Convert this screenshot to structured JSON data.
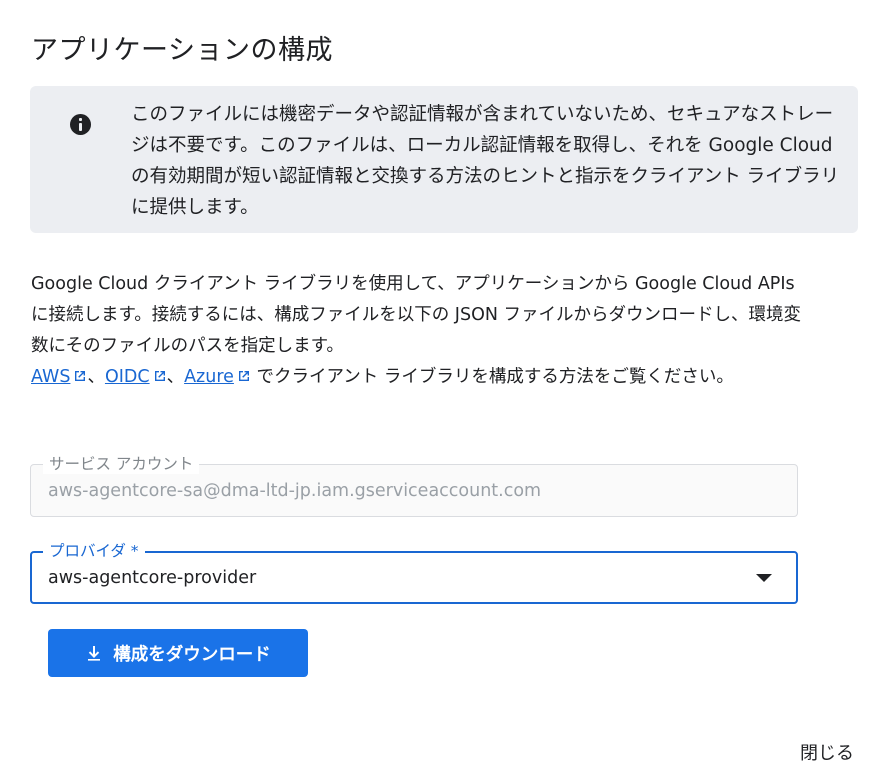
{
  "dialog": {
    "title": "アプリケーションの構成",
    "close_label": "閉じる"
  },
  "info": {
    "icon": "info-icon",
    "text": "このファイルには機密データや認証情報が含まれていないため、セキュアなストレージは不要です。このファイルは、ローカル認証情報を取得し、それを Google Cloud の有効期間が短い認証情報と交換する方法のヒントと指示をクライアント ライブラリに提供します。"
  },
  "description": {
    "text": "Google Cloud クライアント ライブラリを使用して、アプリケーションから Google Cloud APIs に接続します。接続するには、構成ファイルを以下の JSON ファイルからダウンロードし、環境変数にそのファイルのパスを指定します。",
    "link_aws": "AWS",
    "sep1": "、",
    "link_oidc": "OIDC",
    "sep2": "、",
    "link_azure": "Azure",
    "suffix": " でクライアント ライブラリを構成する方法をご覧ください。"
  },
  "service_account": {
    "label": "サービス アカウント",
    "value": "aws-agentcore-sa@dma-ltd-jp.iam.gserviceaccount.com"
  },
  "provider": {
    "label": "プロバイダ *",
    "value": "aws-agentcore-provider"
  },
  "download_button": {
    "label": "構成をダウンロード",
    "icon": "download-icon"
  },
  "colors": {
    "primary": "#1a73e8",
    "link": "#1967d2",
    "info_bg": "#eceef2"
  }
}
